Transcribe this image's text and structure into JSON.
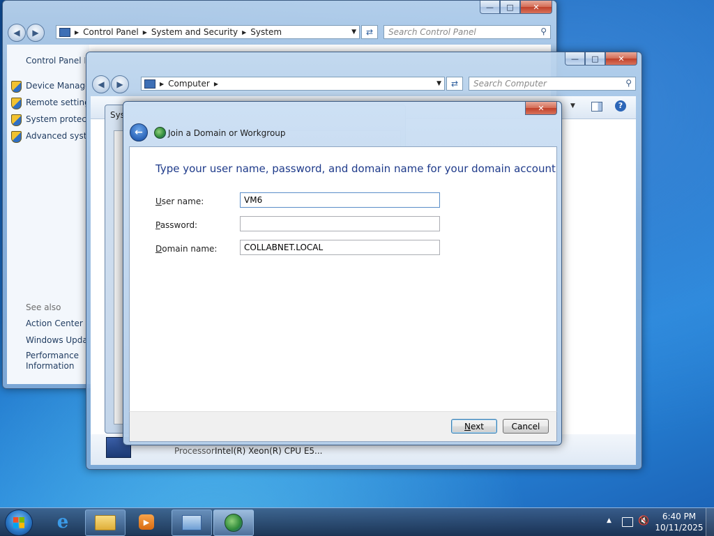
{
  "colors": {
    "heading_blue": "#1e3a8a",
    "link_blue": "#1e3a5f"
  },
  "system_window": {
    "breadcrumb": [
      "Control Panel",
      "System and Security",
      "System"
    ],
    "search_placeholder": "Search Control Panel",
    "sidebar": {
      "home": "Control Panel Home",
      "tasks": [
        "Device Manager",
        "Remote settings",
        "System protection",
        "Advanced system settings"
      ],
      "see_also_heading": "See also",
      "see_also": [
        "Action Center",
        "Windows Update",
        "Performance Information and Tools"
      ]
    }
  },
  "computer_window": {
    "breadcrumb": [
      "Computer"
    ],
    "search_placeholder": "Search Computer",
    "status_label": "Processor:",
    "status_value": "Intel(R) Xeon(R) CPU E5..."
  },
  "system_properties": {
    "title": "Sys"
  },
  "dialog": {
    "title": "Join a Domain or Workgroup",
    "heading": "Type your user name, password, and domain name for your domain account",
    "fields": {
      "username": {
        "label_access": "U",
        "label_rest": "ser name:",
        "value": "VM6"
      },
      "password": {
        "label_access": "P",
        "label_rest": "assword:",
        "value": ""
      },
      "domain": {
        "label_access": "D",
        "label_rest": "omain name:",
        "value": "COLLABNET.LOCAL"
      }
    },
    "next_access": "N",
    "next_rest": "ext",
    "cancel_label": "Cancel"
  },
  "taskbar": {
    "clock_time": "6:40 PM",
    "clock_date": "10/11/2025"
  }
}
